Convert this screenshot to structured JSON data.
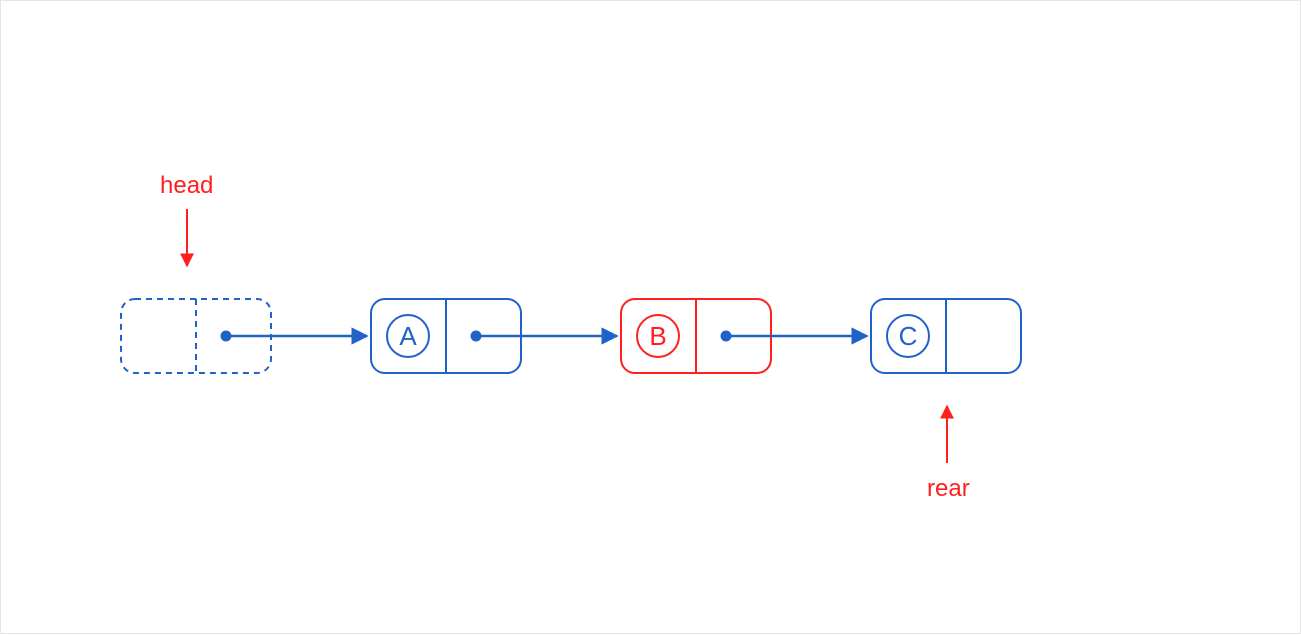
{
  "labels": {
    "head": "head",
    "rear": "rear"
  },
  "nodes": {
    "a": "A",
    "b": "B",
    "c": "C"
  },
  "colors": {
    "blue": "#1f63c9",
    "red": "#ff1f1f"
  }
}
